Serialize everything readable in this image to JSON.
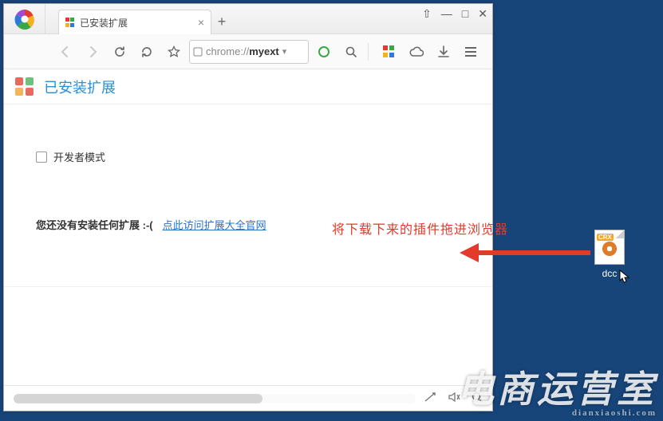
{
  "tab": {
    "title": "已安装扩展"
  },
  "window_controls": {
    "pin": "⇧",
    "min": "—",
    "max": "□",
    "close": "✕"
  },
  "toolbar": {
    "address_prefix": "chrome://",
    "address_path": "myext",
    "dropdown_glyph": "▾"
  },
  "page": {
    "title": "已安装扩展",
    "dev_mode_label": "开发者模式",
    "no_ext_text": "您还没有安装任何扩展 :-(",
    "link_text": "点此访问扩展大全官网"
  },
  "annotation": {
    "text": "将下载下来的插件拖进浏览器"
  },
  "file": {
    "badge": "CRX",
    "label": "dcc"
  },
  "watermark": {
    "main": "电商运营室",
    "sub": "dianxiaoshi.com"
  },
  "colors": {
    "apps": [
      "#e23a2b",
      "#3aa746",
      "#f5b020",
      "#2d7bd8"
    ]
  }
}
